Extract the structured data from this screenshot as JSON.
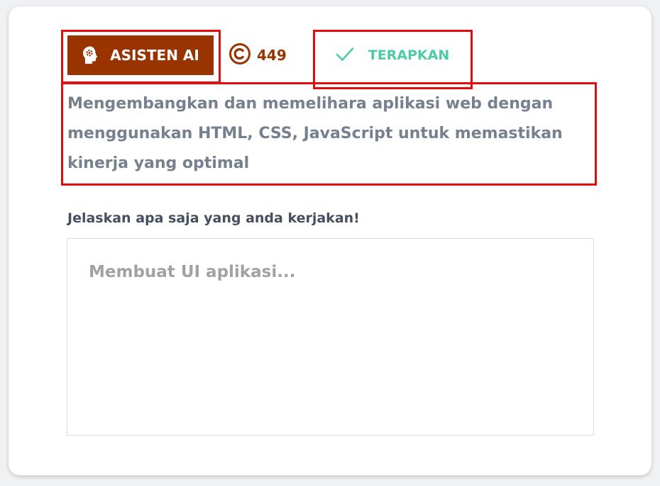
{
  "toolbar": {
    "ai_button_label": "ASISTEN AI",
    "credits": "449",
    "apply_button_label": "TERAPKAN"
  },
  "suggestion": {
    "text": "Mengembangkan dan memelihara aplikasi web dengan menggunakan HTML, CSS, JavaScript untuk memastikan kinerja yang optimal"
  },
  "form": {
    "label": "Jelaskan apa saja yang anda kerjakan!",
    "placeholder": "Membuat UI aplikasi...",
    "value": ""
  },
  "icons": {
    "ai_button": "ai-head-icon",
    "credits": "copyright-icon",
    "apply_button": "check-icon"
  },
  "colors": {
    "brand": "#993300",
    "accent": "#4ecba5",
    "suggestion_text": "#76808f",
    "label_text": "#454f5f",
    "highlight": "#e40d0d",
    "placeholder": "#a2a2a2"
  }
}
